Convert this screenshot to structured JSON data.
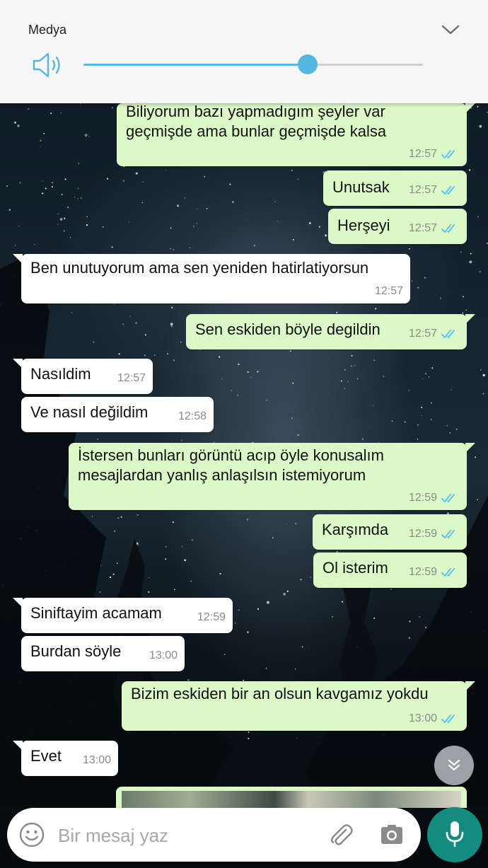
{
  "media_panel": {
    "title": "Medya",
    "volume_level_percent": 66,
    "accent_color": "#52b8e3"
  },
  "messages": [
    {
      "dir": "out",
      "text": "Biliyorum bazı yapmadıgım şeyler var\ngeçmişde ama bunlar geçmişde kalsa",
      "time": "12:57",
      "read": true
    },
    {
      "dir": "out",
      "text": "Unutsak",
      "time": "12:57",
      "read": true
    },
    {
      "dir": "out",
      "text": "Herşeyi",
      "time": "12:57",
      "read": true
    },
    {
      "dir": "in",
      "text": "Ben unutuyorum ama sen yeniden hatirlatiyorsun",
      "time": "12:57"
    },
    {
      "dir": "out",
      "text": "Sen eskiden böyle degildin",
      "time": "12:57",
      "read": true
    },
    {
      "dir": "in",
      "text": "Nasıldim",
      "time": "12:57"
    },
    {
      "dir": "in",
      "text": "Ve nasıl değildim",
      "time": "12:58"
    },
    {
      "dir": "out",
      "text": "İstersen bunları görüntü acıp öyle konusalım\nmesajlardan yanlış anlaşılsın istemiyorum",
      "time": "12:59",
      "read": true
    },
    {
      "dir": "out",
      "text": "Karşımda",
      "time": "12:59",
      "read": true
    },
    {
      "dir": "out",
      "text": "Ol isterim",
      "time": "12:59",
      "read": true
    },
    {
      "dir": "in",
      "text": "Siniftayim acamam",
      "time": "12:59"
    },
    {
      "dir": "in",
      "text": "Burdan söyle",
      "time": "13:00"
    },
    {
      "dir": "out",
      "text": "Bizim eskiden bir an olsun kavgamız yokdu",
      "time": "13:00",
      "read": true
    },
    {
      "dir": "in",
      "text": "Evet",
      "time": "13:00"
    }
  ],
  "input": {
    "placeholder": "Bir mesaj yaz"
  },
  "icons": {
    "collapse": "chevron-down-icon",
    "speaker": "speaker-icon",
    "scroll_down": "double-chevron-down-icon",
    "emoji": "emoji-icon",
    "attach": "paperclip-icon",
    "camera": "camera-icon",
    "mic": "mic-icon"
  },
  "colors": {
    "outgoing_bubble": "#dcf8c6",
    "incoming_bubble": "#ffffff",
    "read_ticks": "#4fc3f7",
    "mic_button": "#128c7e"
  }
}
